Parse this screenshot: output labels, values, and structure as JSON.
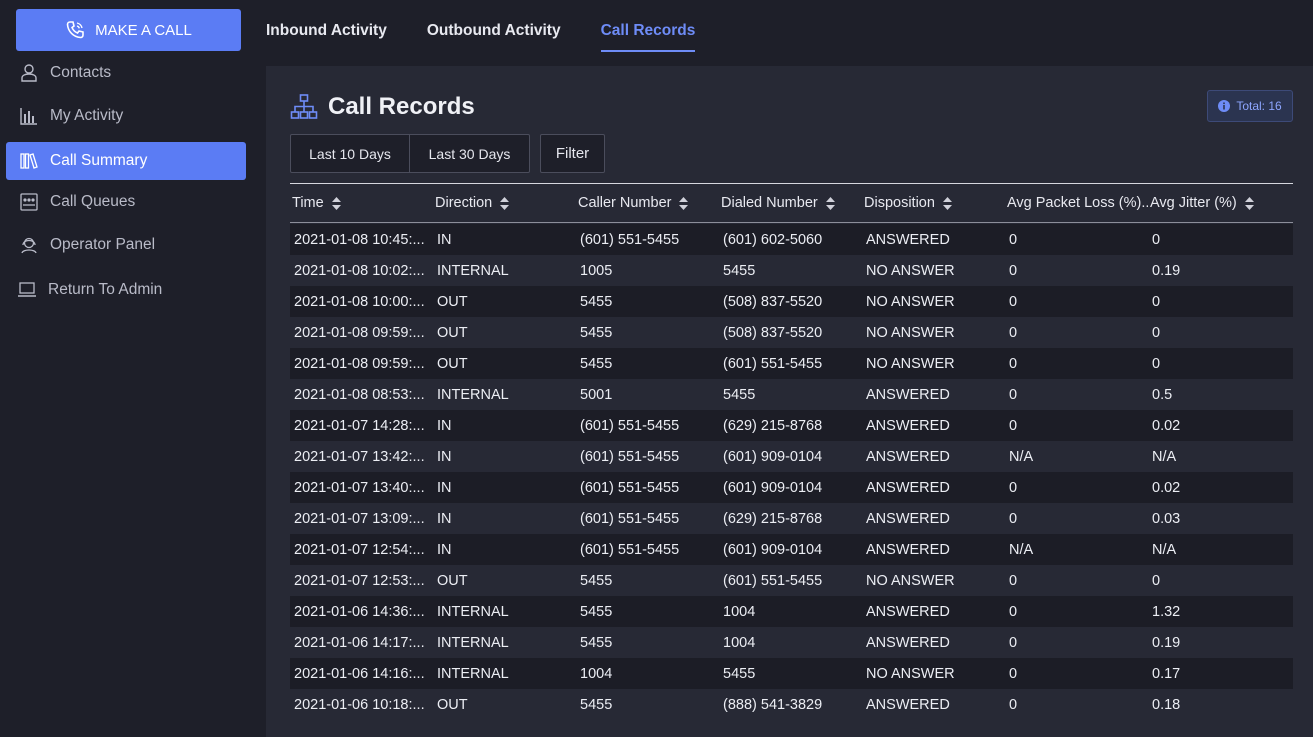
{
  "sidebar": {
    "make_call_label": "MAKE A CALL",
    "items": [
      {
        "label": "Contacts",
        "icon": "contacts-icon"
      },
      {
        "label": "My Activity",
        "icon": "activity-chart-icon"
      },
      {
        "label": "Call Summary",
        "icon": "books-icon",
        "active": true
      },
      {
        "label": "Call Queues",
        "icon": "queue-icon"
      },
      {
        "label": "Operator Panel",
        "icon": "operator-icon"
      },
      {
        "label": "Return To Admin",
        "icon": "laptop-icon"
      }
    ]
  },
  "tabs": [
    {
      "label": "Inbound Activity"
    },
    {
      "label": "Outbound Activity"
    },
    {
      "label": "Call Records",
      "active": true
    }
  ],
  "panel": {
    "title": "Call Records",
    "total_label": "Total: 16",
    "buttons": {
      "last10": "Last 10 Days",
      "last30": "Last 30 Days",
      "filter": "Filter"
    }
  },
  "table": {
    "columns": [
      "Time",
      "Direction",
      "Caller Number",
      "Dialed Number",
      "Disposition",
      "Avg Packet Loss (%)...",
      "Avg Jitter (%)"
    ],
    "rows": [
      [
        "2021-01-08 10:45:...",
        "IN",
        "(601) 551-5455",
        "(601) 602-5060",
        "ANSWERED",
        "0",
        "0"
      ],
      [
        "2021-01-08 10:02:...",
        "INTERNAL",
        "1005",
        "5455",
        "NO ANSWER",
        "0",
        "0.19"
      ],
      [
        "2021-01-08 10:00:...",
        "OUT",
        "5455",
        "(508) 837-5520",
        "NO ANSWER",
        "0",
        "0"
      ],
      [
        "2021-01-08 09:59:...",
        "OUT",
        "5455",
        "(508) 837-5520",
        "NO ANSWER",
        "0",
        "0"
      ],
      [
        "2021-01-08 09:59:...",
        "OUT",
        "5455",
        "(601) 551-5455",
        "NO ANSWER",
        "0",
        "0"
      ],
      [
        "2021-01-08 08:53:...",
        "INTERNAL",
        "5001",
        "5455",
        "ANSWERED",
        "0",
        "0.5"
      ],
      [
        "2021-01-07 14:28:...",
        "IN",
        "(601) 551-5455",
        "(629) 215-8768",
        "ANSWERED",
        "0",
        "0.02"
      ],
      [
        "2021-01-07 13:42:...",
        "IN",
        "(601) 551-5455",
        "(601) 909-0104",
        "ANSWERED",
        "N/A",
        "N/A"
      ],
      [
        "2021-01-07 13:40:...",
        "IN",
        "(601) 551-5455",
        "(601) 909-0104",
        "ANSWERED",
        "0",
        "0.02"
      ],
      [
        "2021-01-07 13:09:...",
        "IN",
        "(601) 551-5455",
        "(629) 215-8768",
        "ANSWERED",
        "0",
        "0.03"
      ],
      [
        "2021-01-07 12:54:...",
        "IN",
        "(601) 551-5455",
        "(601) 909-0104",
        "ANSWERED",
        "N/A",
        "N/A"
      ],
      [
        "2021-01-07 12:53:...",
        "OUT",
        "5455",
        "(601) 551-5455",
        "NO ANSWER",
        "0",
        "0"
      ],
      [
        "2021-01-06 14:36:...",
        "INTERNAL",
        "5455",
        "1004",
        "ANSWERED",
        "0",
        "1.32"
      ],
      [
        "2021-01-06 14:17:...",
        "INTERNAL",
        "5455",
        "1004",
        "ANSWERED",
        "0",
        "0.19"
      ],
      [
        "2021-01-06 14:16:...",
        "INTERNAL",
        "1004",
        "5455",
        "NO ANSWER",
        "0",
        "0.17"
      ],
      [
        "2021-01-06 10:18:...",
        "OUT",
        "5455",
        "(888) 541-3829",
        "ANSWERED",
        "0",
        "0.18"
      ]
    ]
  },
  "colors": {
    "accent": "#5b7cf4",
    "background": "#1e1f29",
    "panel": "#272935"
  }
}
